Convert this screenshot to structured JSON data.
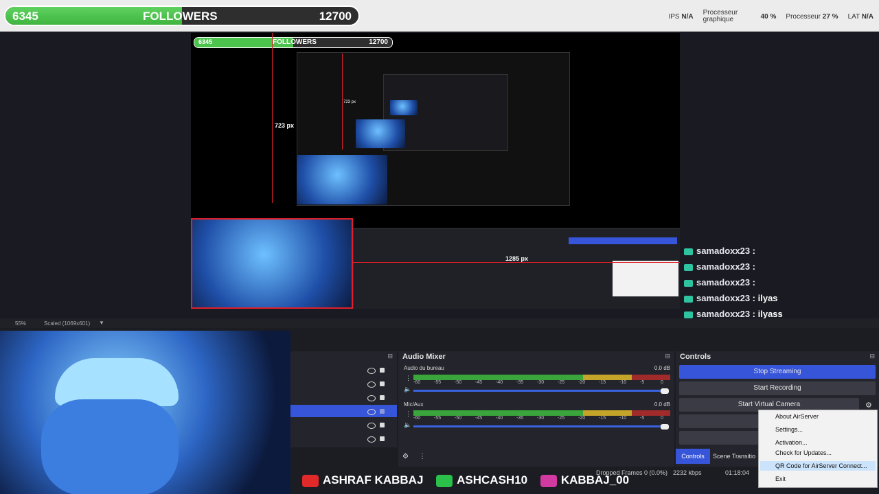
{
  "followers": {
    "current": "6345",
    "label": "FOLLOWERS",
    "goal": "12700",
    "progress": 0.5
  },
  "stats": {
    "ips_label": "IPS",
    "ips_value": "N/A",
    "gpu_label": "Processeur graphique",
    "gpu_value": "40 %",
    "cpu_label": "Processeur",
    "cpu_value": "27 %",
    "lat_label": "LAT",
    "lat_value": "N/A"
  },
  "canvas": {
    "nested_followers_current": "6345",
    "nested_followers_label": "FOLLOWERS",
    "nested_followers_goal": "12700",
    "height_measure": "723 px",
    "width_measure": "1285 px",
    "small_measure": "723 px"
  },
  "chat": [
    {
      "user": "samadoxx23",
      "msg": ""
    },
    {
      "user": "samadoxx23",
      "msg": ""
    },
    {
      "user": "samadoxx23",
      "msg": ""
    },
    {
      "user": "samadoxx23",
      "msg": "ilyas"
    },
    {
      "user": "samadoxx23",
      "msg": "ilyass"
    }
  ],
  "zoom": {
    "percent": "55%",
    "mode": "Scaled (1069x601)"
  },
  "audio_mixer": {
    "title": "Audio Mixer",
    "tracks": [
      {
        "name": "Audio du bureau",
        "db": "0.0 dB",
        "level": 0.71
      },
      {
        "name": "Mic/Aux",
        "db": "0.0 dB",
        "level": 0.54
      }
    ],
    "scale": [
      "-60",
      "-55",
      "-50",
      "-45",
      "-40",
      "-35",
      "-30",
      "-25",
      "-20",
      "-15",
      "-10",
      "-5",
      "0"
    ]
  },
  "controls": {
    "title": "Controls",
    "stop_streaming": "Stop Streaming",
    "start_recording": "Start Recording",
    "start_virtual_camera": "Start Virtual Camera",
    "tab_controls": "Controls",
    "tab_scene_transitions": "Scene Transitio"
  },
  "context_menu": {
    "items": [
      "About AirServer",
      "Settings...",
      "Activation...",
      "Check for Updates...",
      "QR Code for AirServer Connect...",
      "Exit"
    ]
  },
  "social": {
    "youtube": "ASHRAF KABBAJ",
    "kick": "ASHCASH10",
    "instagram": "KABBAJ_00"
  },
  "status": {
    "dropped": "Dropped Frames 0 (0.0%)",
    "bitrate": "2232 kbps",
    "time": "01:18:04"
  }
}
